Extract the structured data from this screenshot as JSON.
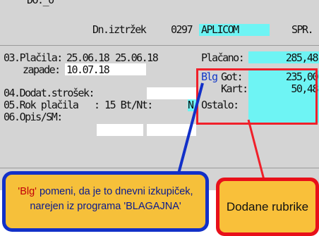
{
  "header": {
    "partial_top": "DO._0",
    "doc_label": "Dn.iztržek",
    "doc_number": "0297",
    "partner": "APLICOM",
    "spr_label": "SPR."
  },
  "form": {
    "placila_label": "03.Plačila:",
    "placila_date1": "25.06.18",
    "placila_date2": "25.06.18",
    "zapade_label": "zapade:",
    "zapade_date": "10.07.18",
    "dodat_label": "04.Dodat.strošek:",
    "rok_label": "05.Rok plačila",
    "rok_value": ": 15 Bt/Nt:",
    "rok_flag": "N",
    "opis_label": "06.Opis/SM:",
    "placano_label": "Plačano:",
    "placano_value": "285,48",
    "blg_label": "Blg",
    "got_label": "Got:",
    "got_value": "235,00",
    "kart_label": "Kart:",
    "kart_value": "50,48",
    "ostalo_label": "Ostalo:"
  },
  "callouts": {
    "blue_blg": "'Blg'",
    "blue_text1": " pomeni, da je to dnevni izkupiček,",
    "blue_text2": "narejen iz programa 'BLAGAJNA'",
    "red_text": "Dodane rubrike"
  },
  "colors": {
    "field_cyan": "#6ef4f4",
    "highlight_red": "#f0202a",
    "callout_blue": "#1230c8",
    "callout_fill": "#f6c03a"
  }
}
